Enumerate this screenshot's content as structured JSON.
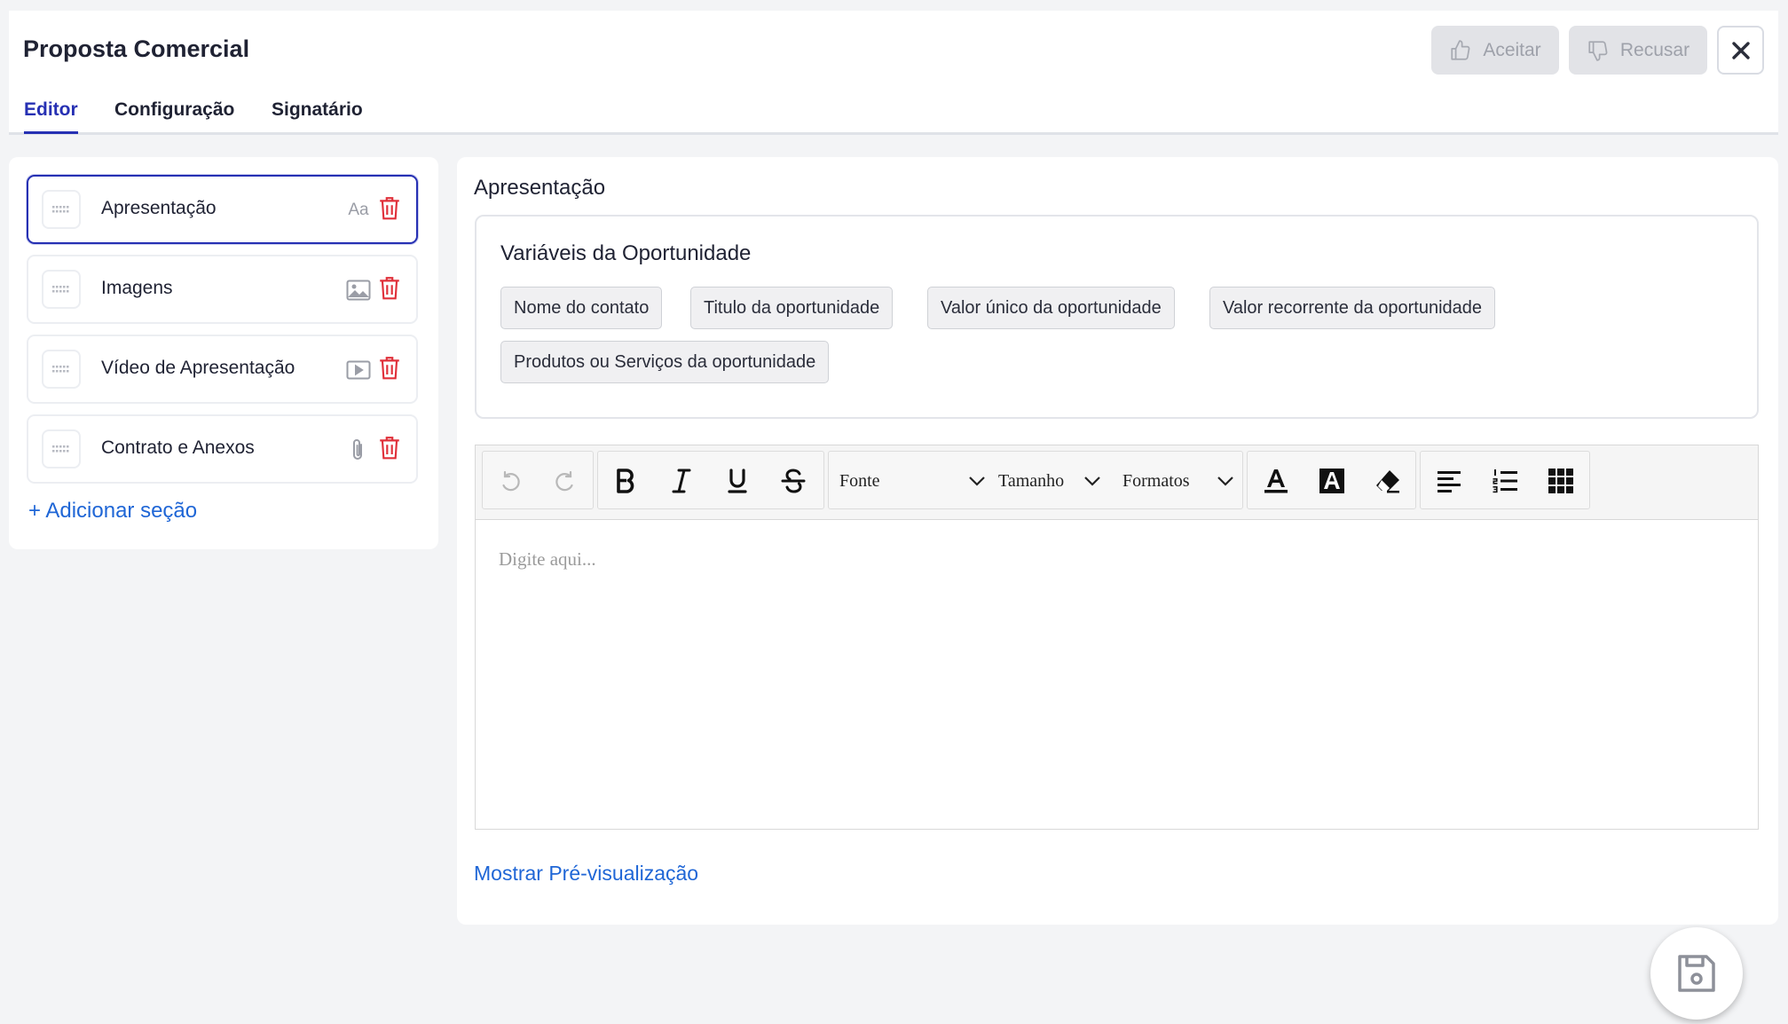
{
  "header": {
    "title": "Proposta Comercial",
    "accept_label": "Aceitar",
    "reject_label": "Recusar"
  },
  "tabs": [
    {
      "label": "Editor",
      "active": true
    },
    {
      "label": "Configuração",
      "active": false
    },
    {
      "label": "Signatário",
      "active": false
    }
  ],
  "sections": {
    "items": [
      {
        "label": "Apresentação",
        "type_icon": "text-type-icon",
        "type_text": "Aa",
        "selected": true
      },
      {
        "label": "Imagens",
        "type_icon": "image-icon",
        "selected": false
      },
      {
        "label": "Vídeo de Apresentação",
        "type_icon": "video-icon",
        "selected": false
      },
      {
        "label": "Contrato e Anexos",
        "type_icon": "paperclip-icon",
        "selected": false
      }
    ],
    "add_label": "+ Adicionar seção"
  },
  "editor_panel": {
    "title": "Apresentação",
    "variables_title": "Variáveis da Oportunidade",
    "variables": [
      "Nome do contato",
      "Titulo da oportunidade",
      "Valor único da oportunidade",
      "Valor recorrente da oportunidade",
      "Produtos ou Serviços da oportunidade"
    ],
    "toolbar": {
      "font_label": "Fonte",
      "size_label": "Tamanho",
      "formats_label": "Formatos"
    },
    "placeholder": "Digite aqui...",
    "preview_label": "Mostrar Pré-visualização"
  },
  "colors": {
    "accent": "#2630b3",
    "link": "#1f66d6",
    "danger": "#e0303a"
  }
}
